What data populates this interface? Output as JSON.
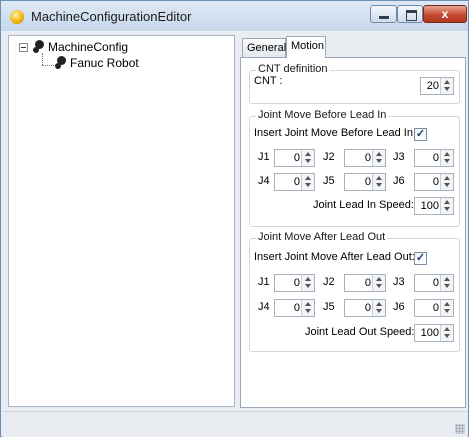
{
  "window": {
    "title": "MachineConfigurationEditor",
    "close_glyph": "x"
  },
  "tree": {
    "root": {
      "label": "MachineConfig",
      "toggle": "-",
      "icon": "gears-icon"
    },
    "child": {
      "label": "Fanuc Robot",
      "icon": "gears-icon"
    }
  },
  "tabs": [
    {
      "label": "General",
      "selected": false
    },
    {
      "label": "Motion",
      "selected": true
    }
  ],
  "cnt": {
    "group_title": "CNT definition",
    "label": "CNT :",
    "value": "20"
  },
  "lead_in": {
    "group_title": "Joint Move Before Lead In",
    "checkbox_label": "Insert Joint Move Before Lead In:",
    "checked": true,
    "joints": [
      {
        "label": "J1",
        "value": "0"
      },
      {
        "label": "J2",
        "value": "0"
      },
      {
        "label": "J3",
        "value": "0"
      },
      {
        "label": "J4",
        "value": "0"
      },
      {
        "label": "J5",
        "value": "0"
      },
      {
        "label": "J6",
        "value": "0"
      }
    ],
    "speed_label": "Joint Lead In Speed:",
    "speed_value": "100"
  },
  "lead_out": {
    "group_title": "Joint Move After Lead Out",
    "checkbox_label": "Insert Joint Move After Lead Out:",
    "checked": true,
    "joints": [
      {
        "label": "J1",
        "value": "0"
      },
      {
        "label": "J2",
        "value": "0"
      },
      {
        "label": "J3",
        "value": "0"
      },
      {
        "label": "J4",
        "value": "0"
      },
      {
        "label": "J5",
        "value": "0"
      },
      {
        "label": "J6",
        "value": "0"
      }
    ],
    "speed_label": "Joint Lead Out Speed:",
    "speed_value": "100"
  },
  "check_glyph": "✓"
}
